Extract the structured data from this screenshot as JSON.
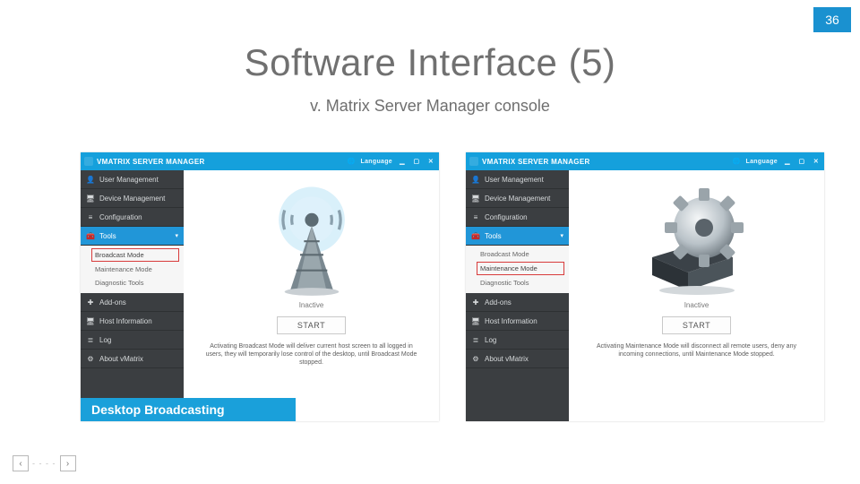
{
  "page_number": "36",
  "title": "Software Interface (5)",
  "subtitle": "v. Matrix Server Manager console",
  "app_name": "VMATRIX SERVER MANAGER",
  "titlebar_lang": "Language",
  "sidebar": {
    "user_mgmt": "User Management",
    "device_mgmt": "Device Management",
    "configuration": "Configuration",
    "tools": "Tools",
    "broadcast_mode": "Broadcast Mode",
    "maintenance_mode": "Maintenance Mode",
    "diagnostic_tools": "Diagnostic Tools",
    "addons": "Add-ons",
    "host_info": "Host Information",
    "log": "Log",
    "about": "About vMatrix"
  },
  "left_panel": {
    "status": "Inactive",
    "button": "START",
    "desc": "Activating Broadcast Mode will deliver current host screen to all logged in users, they will temporarily lose control of the desktop, until Broadcast Mode stopped.",
    "caption": "Desktop Broadcasting"
  },
  "right_panel": {
    "status": "Inactive",
    "button": "START",
    "desc": "Activating Maintenance Mode will disconnect all remote users, deny any incoming connections, until Maintenance Mode stopped."
  },
  "icons": {
    "user": "user-icon",
    "device": "device-icon",
    "config": "sliders-icon",
    "tools": "toolbox-icon",
    "addons": "plus-icon",
    "host": "monitor-icon",
    "log": "list-icon",
    "about": "gear-icon",
    "chevron": "chevron-down-icon",
    "globe": "globe-icon",
    "min": "minimize-icon",
    "max": "maximize-icon",
    "close": "close-icon"
  }
}
